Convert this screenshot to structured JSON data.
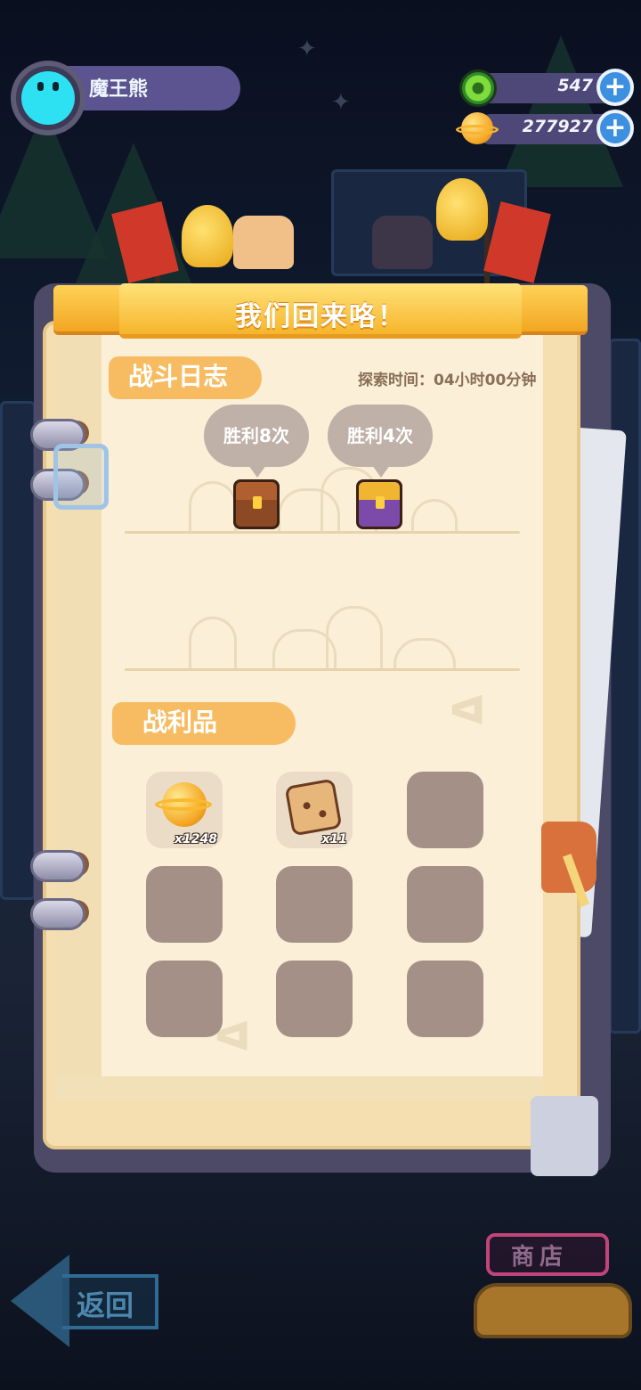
{
  "hud": {
    "player_name": "魔王熊",
    "gems": "547",
    "coins": "277927"
  },
  "panel": {
    "banner_title": "我们回来咯！",
    "log_title": "战斗日志",
    "explore_time": "探索时间：04小时00分钟",
    "victories": [
      {
        "label": "胜利8次",
        "chest": "wooden-chest-icon",
        "color": "#8b4a24"
      },
      {
        "label": "胜利4次",
        "chest": "purple-chest-icon",
        "color": "#7c4aa8"
      }
    ],
    "loot_title": "战利品",
    "loot": [
      {
        "item": "coin-icon",
        "count": "x1248"
      },
      {
        "item": "cat-map-icon",
        "count": "x11"
      }
    ]
  },
  "nav": {
    "back_label": "返回",
    "shop_label": "商店"
  }
}
